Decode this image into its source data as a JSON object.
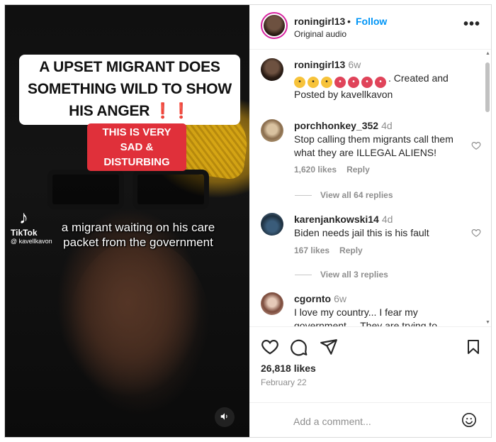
{
  "media": {
    "headline_line1": "A UPSET MIGRANT DOES",
    "headline_line2": "SOMETHING WILD TO SHOW",
    "headline_line3": "HIS ANGER",
    "headline_bangs": "❗❗",
    "red_box_line1": "THIS IS VERY SAD &",
    "red_box_line2": "DISTURBING",
    "tiktok_brand": "TikTok",
    "tiktok_handle": "@ kavellkavon",
    "subtitle_line1": "a migrant waiting on his care",
    "subtitle_line2": "packet from the government",
    "mute_icon": "speaker-icon"
  },
  "header": {
    "username": "roningirl13",
    "dot": "•",
    "follow_label": "Follow",
    "audio_label": "Original audio",
    "more_icon": "more-icon"
  },
  "caption": {
    "username": "roningirl13",
    "time": "6w",
    "text": ". Created and Posted by kavellkavon"
  },
  "comments": [
    {
      "username": "porchhonkey_352",
      "time": "4d",
      "text": "Stop calling them migrants call them what they are ILLEGAL ALIENS!",
      "likes": "1,620 likes",
      "reply": "Reply",
      "view_replies": "View all 64 replies"
    },
    {
      "username": "karenjankowski14",
      "time": "4d",
      "text": "Biden needs jail this is his fault",
      "likes": "167 likes",
      "reply": "Reply",
      "view_replies": "View all 3 replies"
    },
    {
      "username": "cgornto",
      "time": "6w",
      "text": "I love my country... I fear my government.... They are trying to"
    }
  ],
  "actions": {
    "likes_count": "26,818 likes",
    "date": "February 22"
  },
  "add_comment": {
    "placeholder": "Add a comment..."
  },
  "colors": {
    "accent_blue": "#0095f6",
    "muted_text": "#8e8e8e",
    "text": "#262626",
    "video_red_box": "#e0303a"
  }
}
